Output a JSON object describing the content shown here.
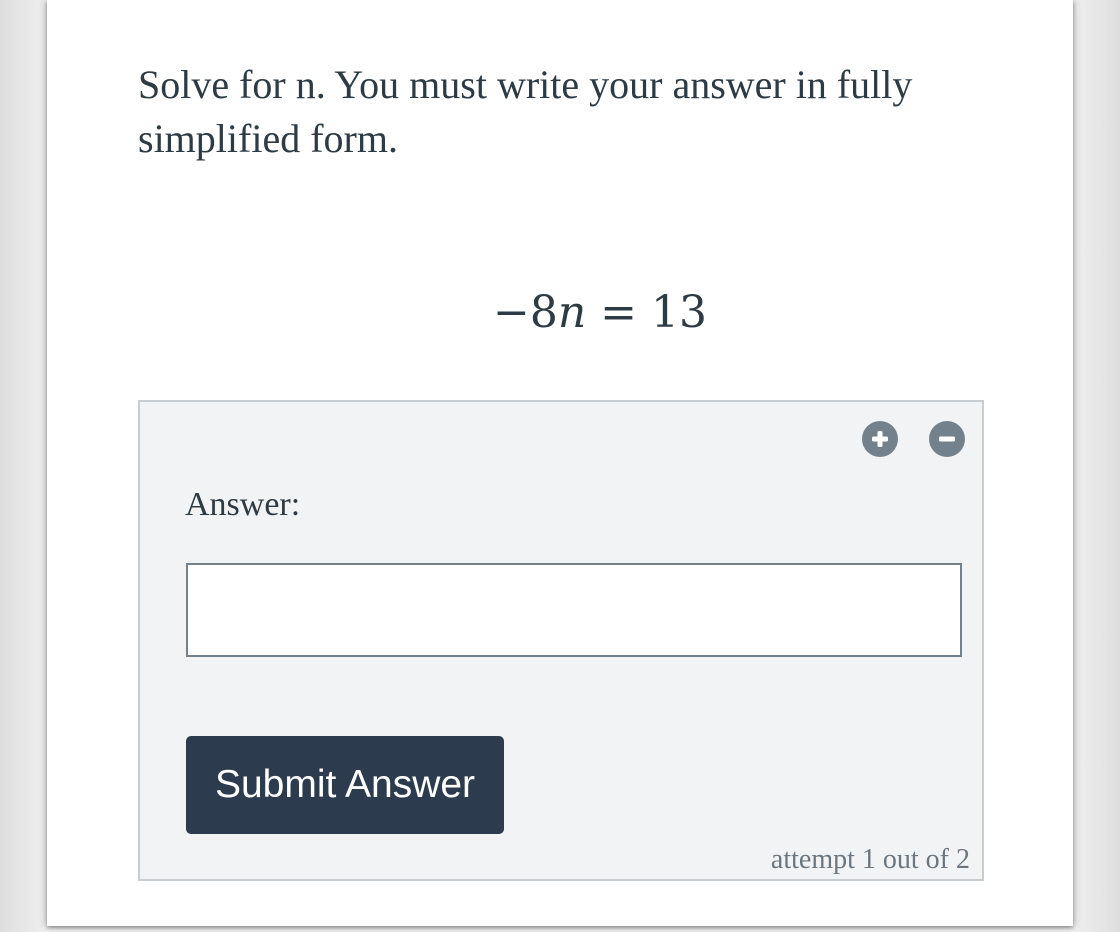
{
  "question": {
    "text": "Solve for n. You must write your answer in fully simplified form."
  },
  "equation": {
    "lhs_coefficient": "−8",
    "variable": "n",
    "operator": "=",
    "rhs": "13"
  },
  "answer_panel": {
    "add_icon": "plus-circle-icon",
    "remove_icon": "minus-circle-icon",
    "label": "Answer:",
    "input_value": "",
    "input_placeholder": "",
    "submit_label": "Submit Answer",
    "attempt_text": "attempt 1 out of 2"
  },
  "colors": {
    "text": "#2d3b45",
    "button_bg": "#2d3b4e",
    "icon_gray": "#73818c",
    "panel_bg": "#f2f3f5",
    "panel_border": "#c7cdd1"
  }
}
